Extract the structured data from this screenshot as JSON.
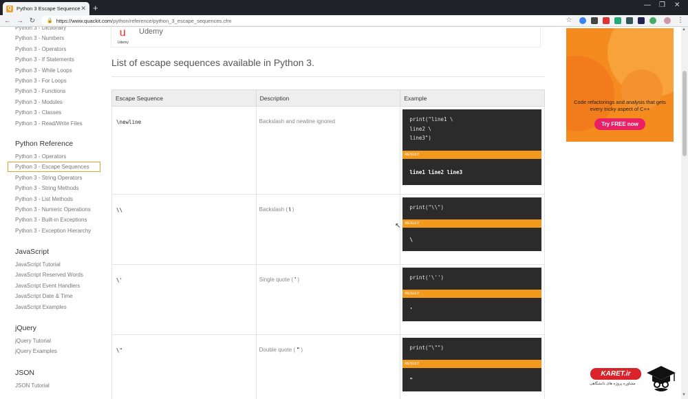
{
  "browser": {
    "tab_title": "Python 3 Escape Sequences",
    "tab_favicon": "Q",
    "url_domain": "https://www.quackit.com",
    "url_path": "/python/reference/python_3_escape_sequences.cfm"
  },
  "sidebar": {
    "top_links": [
      "Python 3 - Dictionary",
      "Python 3 - Numbers",
      "Python 3 - Operators",
      "Python 3 - If Statements",
      "Python 3 - While Loops",
      "Python 3 - For Loops",
      "Python 3 - Functions",
      "Python 3 - Modules",
      "Python 3 - Classes",
      "Python 3 - Read/Write Files"
    ],
    "python_reference": {
      "heading": "Python Reference",
      "links": [
        "Python 3 - Operators",
        "Python 3 - Escape Sequences",
        "Python 3 - String Operators",
        "Python 3 - String Methods",
        "Python 3 - List Methods",
        "Python 3 - Numeric Operations",
        "Python 3 - Built-in Exceptions",
        "Python 3 - Exception Hierarchy"
      ],
      "active_index": 1
    },
    "javascript": {
      "heading": "JavaScript",
      "links": [
        "JavaScript Tutorial",
        "JavaScript Reserved Words",
        "JavaScript Event Handlers",
        "JavaScript Date & Time",
        "JavaScript Examples"
      ]
    },
    "jquery": {
      "heading": "jQuery",
      "links": [
        "jQuery Tutorial",
        "jQuery Examples"
      ]
    },
    "json": {
      "heading": "JSON",
      "links": [
        "JSON Tutorial"
      ]
    }
  },
  "udemy": {
    "logo_text": "Udemy",
    "name": "Udemy"
  },
  "main": {
    "section_title": "List of escape sequences available in Python 3.",
    "table": {
      "headers": [
        "Escape Sequence",
        "Description",
        "Example"
      ],
      "result_label": "RESULT",
      "rows": [
        {
          "sequence": "\\newline",
          "description": "Backslash and newline ignored",
          "description_symbol": "",
          "code": "print(\"line1 \\\nline2 \\\nline3\")",
          "result": "line1 line2 line3"
        },
        {
          "sequence": "\\\\",
          "description": "Backslash",
          "description_symbol": "\\",
          "code": "print(\"\\\\\")",
          "result": "\\"
        },
        {
          "sequence": "\\'",
          "description": "Single quote",
          "description_symbol": "'",
          "code": "print('\\'')",
          "result": "'"
        },
        {
          "sequence": "\\\"",
          "description": "Double quote",
          "description_symbol": "\"",
          "code": "print(\"\\\"\")",
          "result": "\""
        }
      ]
    }
  },
  "ad": {
    "text": "Code refactorings and analysis that gets every tricky aspect of C++",
    "button": "Try FREE now",
    "colors": {
      "background": "#f58a1f",
      "button": "#ea1f66"
    }
  },
  "watermark": {
    "brand": "KARET.ir",
    "subtitle": "مشاوره پروژه های دانشگاهی"
  },
  "colors": {
    "code_bg": "#2b2b2b",
    "result_label": "#f39a1c",
    "active_border": "#e0a030"
  }
}
